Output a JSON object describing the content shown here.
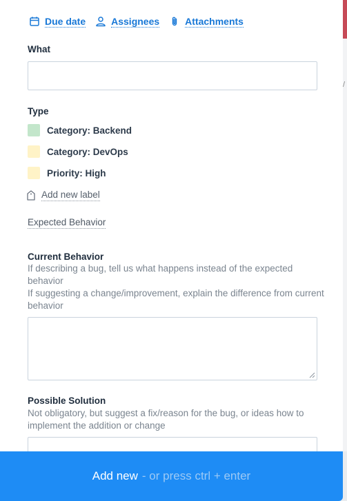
{
  "top_links": [
    {
      "label": "Due date",
      "icon": "calendar-icon"
    },
    {
      "label": "Assignees",
      "icon": "user-icon"
    },
    {
      "label": "Attachments",
      "icon": "paperclip-icon"
    }
  ],
  "what": {
    "label": "What",
    "value": "",
    "placeholder": ""
  },
  "type": {
    "label": "Type",
    "labels": [
      {
        "name": "Category: Backend",
        "color": "#c3e6cb"
      },
      {
        "name": "Category: DevOps",
        "color": "#fff3c7"
      },
      {
        "name": "Priority: High",
        "color": "#fff3c7"
      }
    ],
    "add_label": "Add new label"
  },
  "expected_behavior": {
    "label": "Expected Behavior"
  },
  "current_behavior": {
    "label": "Current Behavior",
    "help_line_1": "If describing a bug, tell us what happens instead of the expected behavior",
    "help_line_2": "If suggesting a change/improvement, explain the difference from current behavior",
    "value": ""
  },
  "possible_solution": {
    "label": "Possible Solution",
    "help": "Not obligatory, but suggest a fix/reason for the bug, or ideas how to implement the addition or change",
    "value": ""
  },
  "submit": {
    "label": "Add new",
    "hint": "- or press ctrl + enter"
  },
  "colors": {
    "accent": "#1e8cf5",
    "link": "#1878d7"
  }
}
